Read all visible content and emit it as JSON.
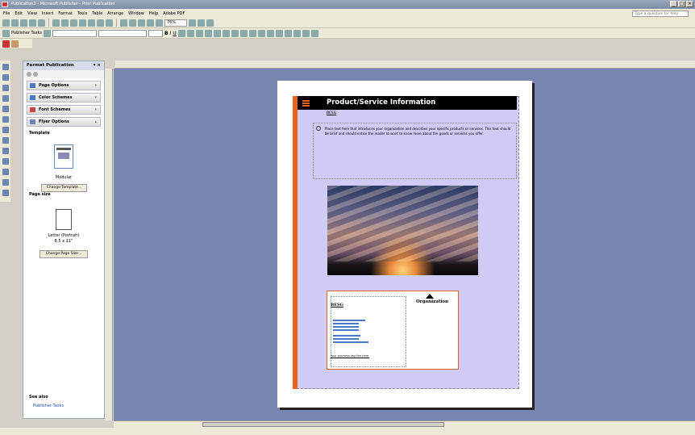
{
  "window": {
    "title": "Publication2 - Microsoft Publisher - Print Publication"
  },
  "menu": [
    "File",
    "Edit",
    "View",
    "Insert",
    "Format",
    "Tools",
    "Table",
    "Arrange",
    "Window",
    "Help",
    "Adobe PDF"
  ],
  "ask_placeholder": "Type a question for help",
  "toolbar": {
    "zoom": "76%",
    "publisher_tasks": "Publisher Tasks"
  },
  "taskpane": {
    "title": "Format Publication",
    "sections": [
      "Page Options",
      "Color Schemes",
      "Font Schemes",
      "Flyer Options"
    ],
    "template_label": "Template",
    "template_name": "Modular",
    "change_template": "Change Template...",
    "page_size_label": "Page size",
    "page_size_name": "Letter (Portrait)",
    "page_size_dims": "8.5 x 11\"",
    "change_page_size": "Change Page Size...",
    "see_also": "See also",
    "see_also_link": "Publisher Tasks"
  },
  "publication": {
    "header_title": "Product/Service Information",
    "subhead": "BESG",
    "intro": "Place text here that introduces your organization and describes your specific products or services. This text should be brief and should entice the reader to want to know more about the goods or services you offer.",
    "org_name": "Organization",
    "biz_name": "BESG",
    "tagline": "Your business tag line here."
  },
  "colors": {
    "accent": "#e8641e",
    "canvas": "#7b85b2",
    "header": "#000000"
  }
}
